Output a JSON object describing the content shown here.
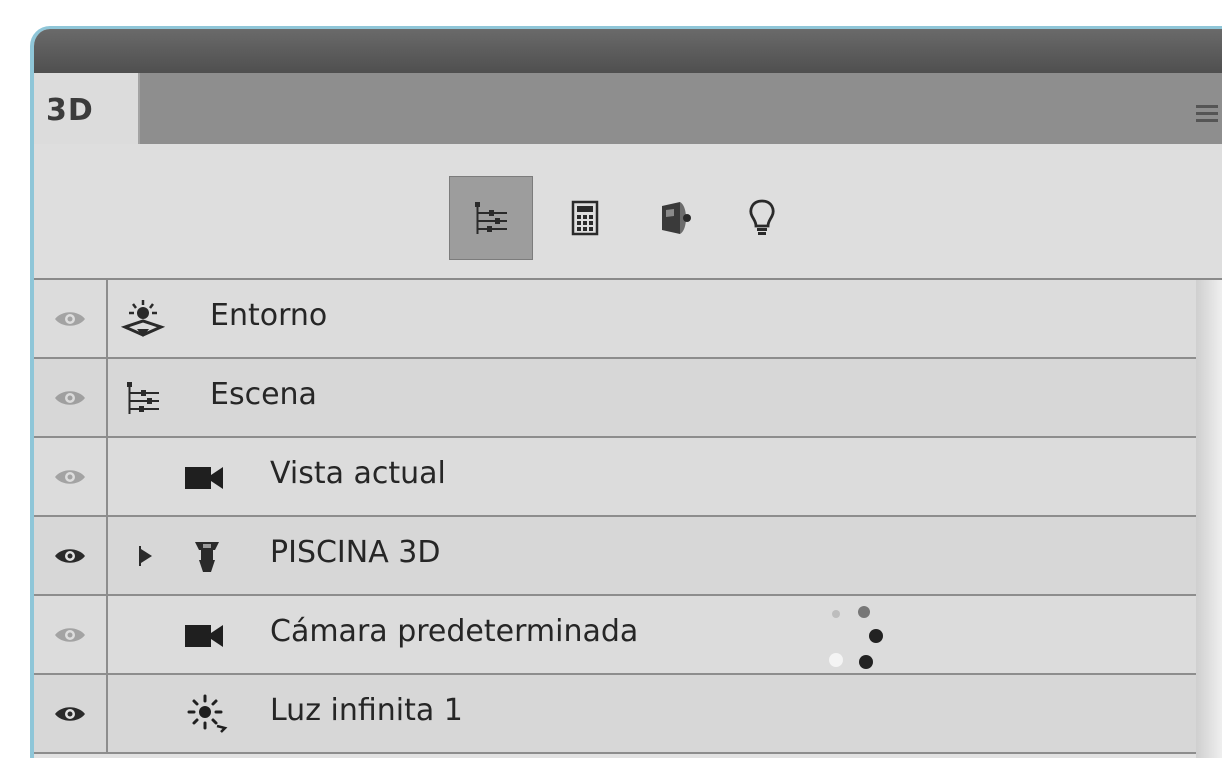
{
  "panel": {
    "tab_label": "3D"
  },
  "toolbar": {
    "buttons": [
      {
        "icon": "scene-filter-icon",
        "active": true
      },
      {
        "icon": "mesh-filter-icon",
        "active": false
      },
      {
        "icon": "materials-filter-icon",
        "active": false
      },
      {
        "icon": "lights-filter-icon",
        "active": false
      }
    ]
  },
  "layers": [
    {
      "label": "Entorno",
      "icon": "environment-icon",
      "visible": false,
      "indent": 0
    },
    {
      "label": "Escena",
      "icon": "scene-icon",
      "visible": false,
      "indent": 0
    },
    {
      "label": "Vista actual",
      "icon": "camera-icon",
      "visible": false,
      "indent": 1
    },
    {
      "label": "PISCINA 3D",
      "icon": "mesh-icon",
      "visible": true,
      "indent": 1,
      "expandable": true
    },
    {
      "label": "Cámara predeterminada",
      "icon": "camera-icon",
      "visible": false,
      "indent": 1
    },
    {
      "label": "Luz infinita 1",
      "icon": "infinite-light-icon",
      "visible": true,
      "indent": 1
    }
  ],
  "colors": {
    "panel_border": "#8fc6d8",
    "titlebar": "#5a5a5a",
    "panel_bg": "#dcdcdc"
  }
}
